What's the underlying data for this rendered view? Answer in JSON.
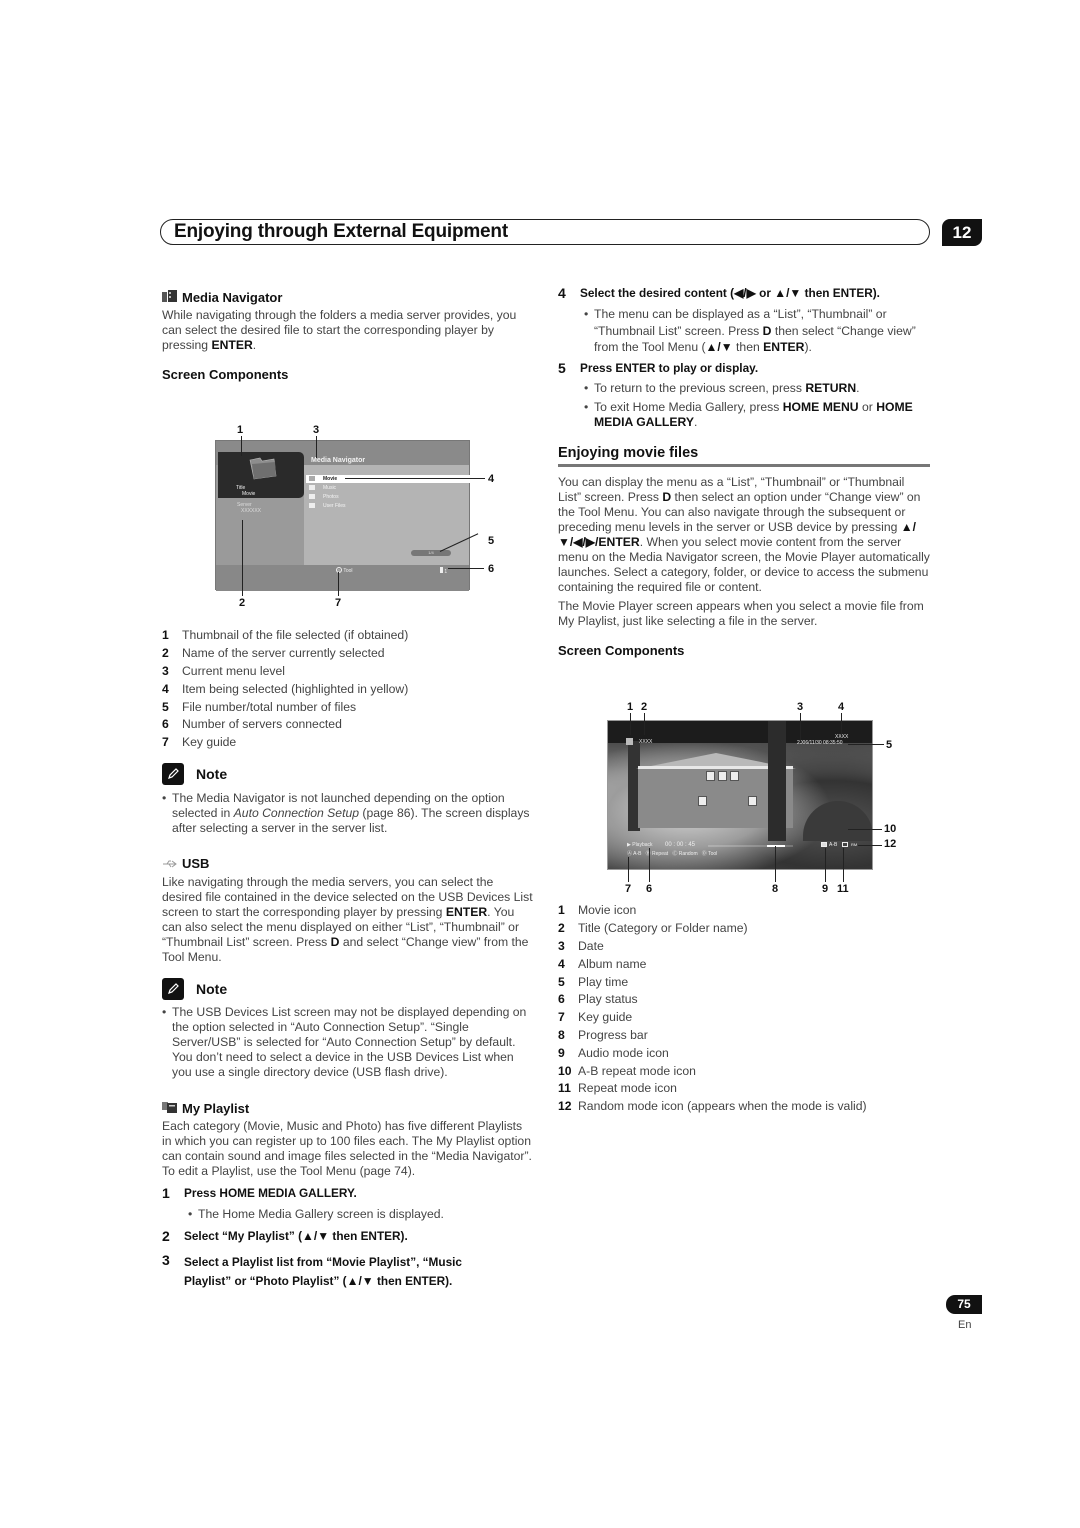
{
  "header": {
    "chapter_title": "Enjoying through External Equipment",
    "chapter_number": "12"
  },
  "left": {
    "media_navigator": {
      "heading": "Media Navigator",
      "icon": "media-navigator-icon",
      "intro_before": "While navigating through the folders a media server provides, you can select the desired file to start the corresponding player by pressing ",
      "intro_bold": "ENTER",
      "intro_after": ".",
      "screen_components_heading": "Screen Components",
      "screenshot": {
        "title": "Media Navigator",
        "thumb_title_label": "Title",
        "thumb_title_value": "Movie",
        "server_label": "Server",
        "server_value": "XXXXXX",
        "items": [
          "Movie",
          "Music",
          "Photos",
          "User Files"
        ],
        "selected_item": "Movie",
        "file_counter": "1/4",
        "key_guide_key": "D",
        "key_guide_label": "Tool",
        "servers_connected": "1"
      },
      "callouts": [
        "1",
        "3",
        "4",
        "5",
        "6",
        "2",
        "7"
      ],
      "components": [
        {
          "n": "1",
          "text": "Thumbnail of the file selected (if obtained)"
        },
        {
          "n": "2",
          "text": "Name of the server currently selected"
        },
        {
          "n": "3",
          "text": "Current menu level"
        },
        {
          "n": "4",
          "text": "Item being selected (highlighted in yellow)"
        },
        {
          "n": "5",
          "text": "File number/total number of files"
        },
        {
          "n": "6",
          "text": "Number of servers connected"
        },
        {
          "n": "7",
          "text": "Key guide"
        }
      ],
      "note": {
        "label": "Note",
        "bullet_a": "The Media Navigator is not launched depending on the option selected in ",
        "bullet_italic": "Auto Connection Setup",
        "bullet_b": " (page 86). The screen displays after selecting a server in the server list."
      }
    },
    "usb": {
      "heading": "USB",
      "icon": "usb-icon",
      "p1": "Like navigating through the media servers, you can select the desired file contained in the device selected on the USB Devices List screen to start the corresponding player by pressing ",
      "p1_bold": "ENTER",
      "p2": ". You can also select the menu displayed on either “List”, “Thumbnail” or “Thumbnail List” screen. Press ",
      "p2_bold": "D",
      "p3": " and select “Change view” from the Tool Menu.",
      "note": {
        "label": "Note",
        "bullet": "The USB Devices List screen may not be displayed depending on the option selected in “Auto Connection Setup”. “Single Server/USB” is selected for “Auto Connection Setup” by default. You don’t need to select a device in the USB Devices List when you use a single directory device (USB flash drive)."
      }
    },
    "my_playlist": {
      "heading": "My Playlist",
      "icon": "playlist-icon",
      "body": "Each category (Movie, Music and Photo) has five different Playlists in which you can register up to 100 files each. The My Playlist option can contain sound and image files selected in the “Media Navigator”. To edit a Playlist, use the Tool Menu (page 74).",
      "steps": [
        {
          "n": "1",
          "text": "Press HOME MEDIA GALLERY.",
          "bullet": "The Home Media Gallery screen is displayed."
        },
        {
          "n": "2",
          "text_a": "Select “My Playlist” (",
          "text_b": " then ENTER)."
        },
        {
          "n": "3",
          "line1": "Select a Playlist list from “Movie Playlist”, “Music",
          "line2_a": "Playlist” or “Photo Playlist” (",
          "line2_b": " then ENTER)."
        }
      ]
    }
  },
  "right": {
    "step4": {
      "n": "4",
      "text_a": "Select the desired content (",
      "text_mid": " or ",
      "text_b": " then ENTER).",
      "bullet_a": "The menu can be displayed as a “List”, “Thumbnail” or “Thumbnail List” screen. Press ",
      "bullet_bold1": "D",
      "bullet_b": " then select “Change view” from the Tool Menu (",
      "bullet_c": " then ",
      "bullet_bold2": "ENTER",
      "bullet_d": ")."
    },
    "step5": {
      "n": "5",
      "text": "Press ENTER to play or display.",
      "bullet1_a": "To return to the previous screen, press ",
      "bullet1_bold": "RETURN",
      "bullet1_b": ".",
      "bullet2_a": "To exit Home Media Gallery, press ",
      "bullet2_bold1": "HOME MENU",
      "bullet2_b": " or ",
      "bullet2_bold2": "HOME MEDIA GALLERY",
      "bullet2_c": "."
    },
    "movie": {
      "heading": "Enjoying movie files",
      "p1_a": "You can display the menu as a “List”, “Thumbnail” or “Thumbnail List” screen. Press ",
      "p1_bold": "D",
      "p1_b": " then select an option under “Change view” on the Tool Menu. You can also navigate through the subsequent or preceding menu levels in the server or USB device by pressing ",
      "p1_bold2": "/ENTER",
      "p1_c": ". When you select movie content from the server menu on the Media Navigator screen, the Movie Player automatically launches. Select a category, folder, or device to access the submenu containing the required file or content.",
      "p2": "The Movie Player screen appears when you select a movie file from My Playlist, just like selecting a file in the server.",
      "screen_components_heading": "Screen Components",
      "screenshot": {
        "title": "XXXX",
        "album": "XXXX",
        "date_time": "2006/11/30 08:35:50",
        "play_status": "▶ Playback",
        "play_time": "00 : 00 : 45",
        "progress": 0.9,
        "keys": [
          {
            "key": "A",
            "label": "A-B"
          },
          {
            "key": "B",
            "label": "Repeat"
          },
          {
            "key": "C",
            "label": "Random"
          },
          {
            "key": "D",
            "label": "Tool"
          }
        ],
        "ab_label": "A-B",
        "random_label": "RM"
      },
      "callouts_top": [
        "1",
        "2",
        "3",
        "4"
      ],
      "callouts_right": [
        "5",
        "10",
        "12"
      ],
      "callouts_bottom": [
        "7",
        "6",
        "8",
        "9",
        "11"
      ],
      "components": [
        {
          "n": "1",
          "text": "Movie icon"
        },
        {
          "n": "2",
          "text": "Title (Category or Folder name)"
        },
        {
          "n": "3",
          "text": "Date"
        },
        {
          "n": "4",
          "text": "Album name"
        },
        {
          "n": "5",
          "text": "Play time"
        },
        {
          "n": "6",
          "text": "Play status"
        },
        {
          "n": "7",
          "text": "Key guide"
        },
        {
          "n": "8",
          "text": "Progress bar"
        },
        {
          "n": "9",
          "text": "Audio mode icon"
        },
        {
          "n": "10",
          "text": "A-B repeat mode icon"
        },
        {
          "n": "11",
          "text": "Repeat mode icon"
        },
        {
          "n": "12",
          "text": "Random mode icon (appears when the mode is valid)"
        }
      ]
    }
  },
  "footer": {
    "page_number": "75",
    "language": "En"
  }
}
